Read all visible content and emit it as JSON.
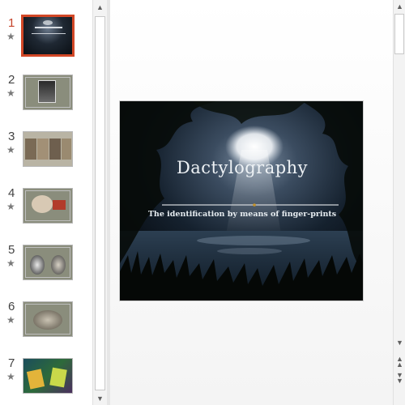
{
  "thumbnails": [
    {
      "number": "1",
      "selected": true
    },
    {
      "number": "2",
      "selected": false
    },
    {
      "number": "3",
      "selected": false
    },
    {
      "number": "4",
      "selected": false
    },
    {
      "number": "5",
      "selected": false
    },
    {
      "number": "6",
      "selected": false
    },
    {
      "number": "7",
      "selected": false
    }
  ],
  "star_glyph": "★",
  "slide": {
    "title": "Dactylography",
    "subtitle": "The identification by means of finger-prints"
  },
  "colors": {
    "selected_border": "#d24726",
    "active_number": "#c5432a"
  }
}
